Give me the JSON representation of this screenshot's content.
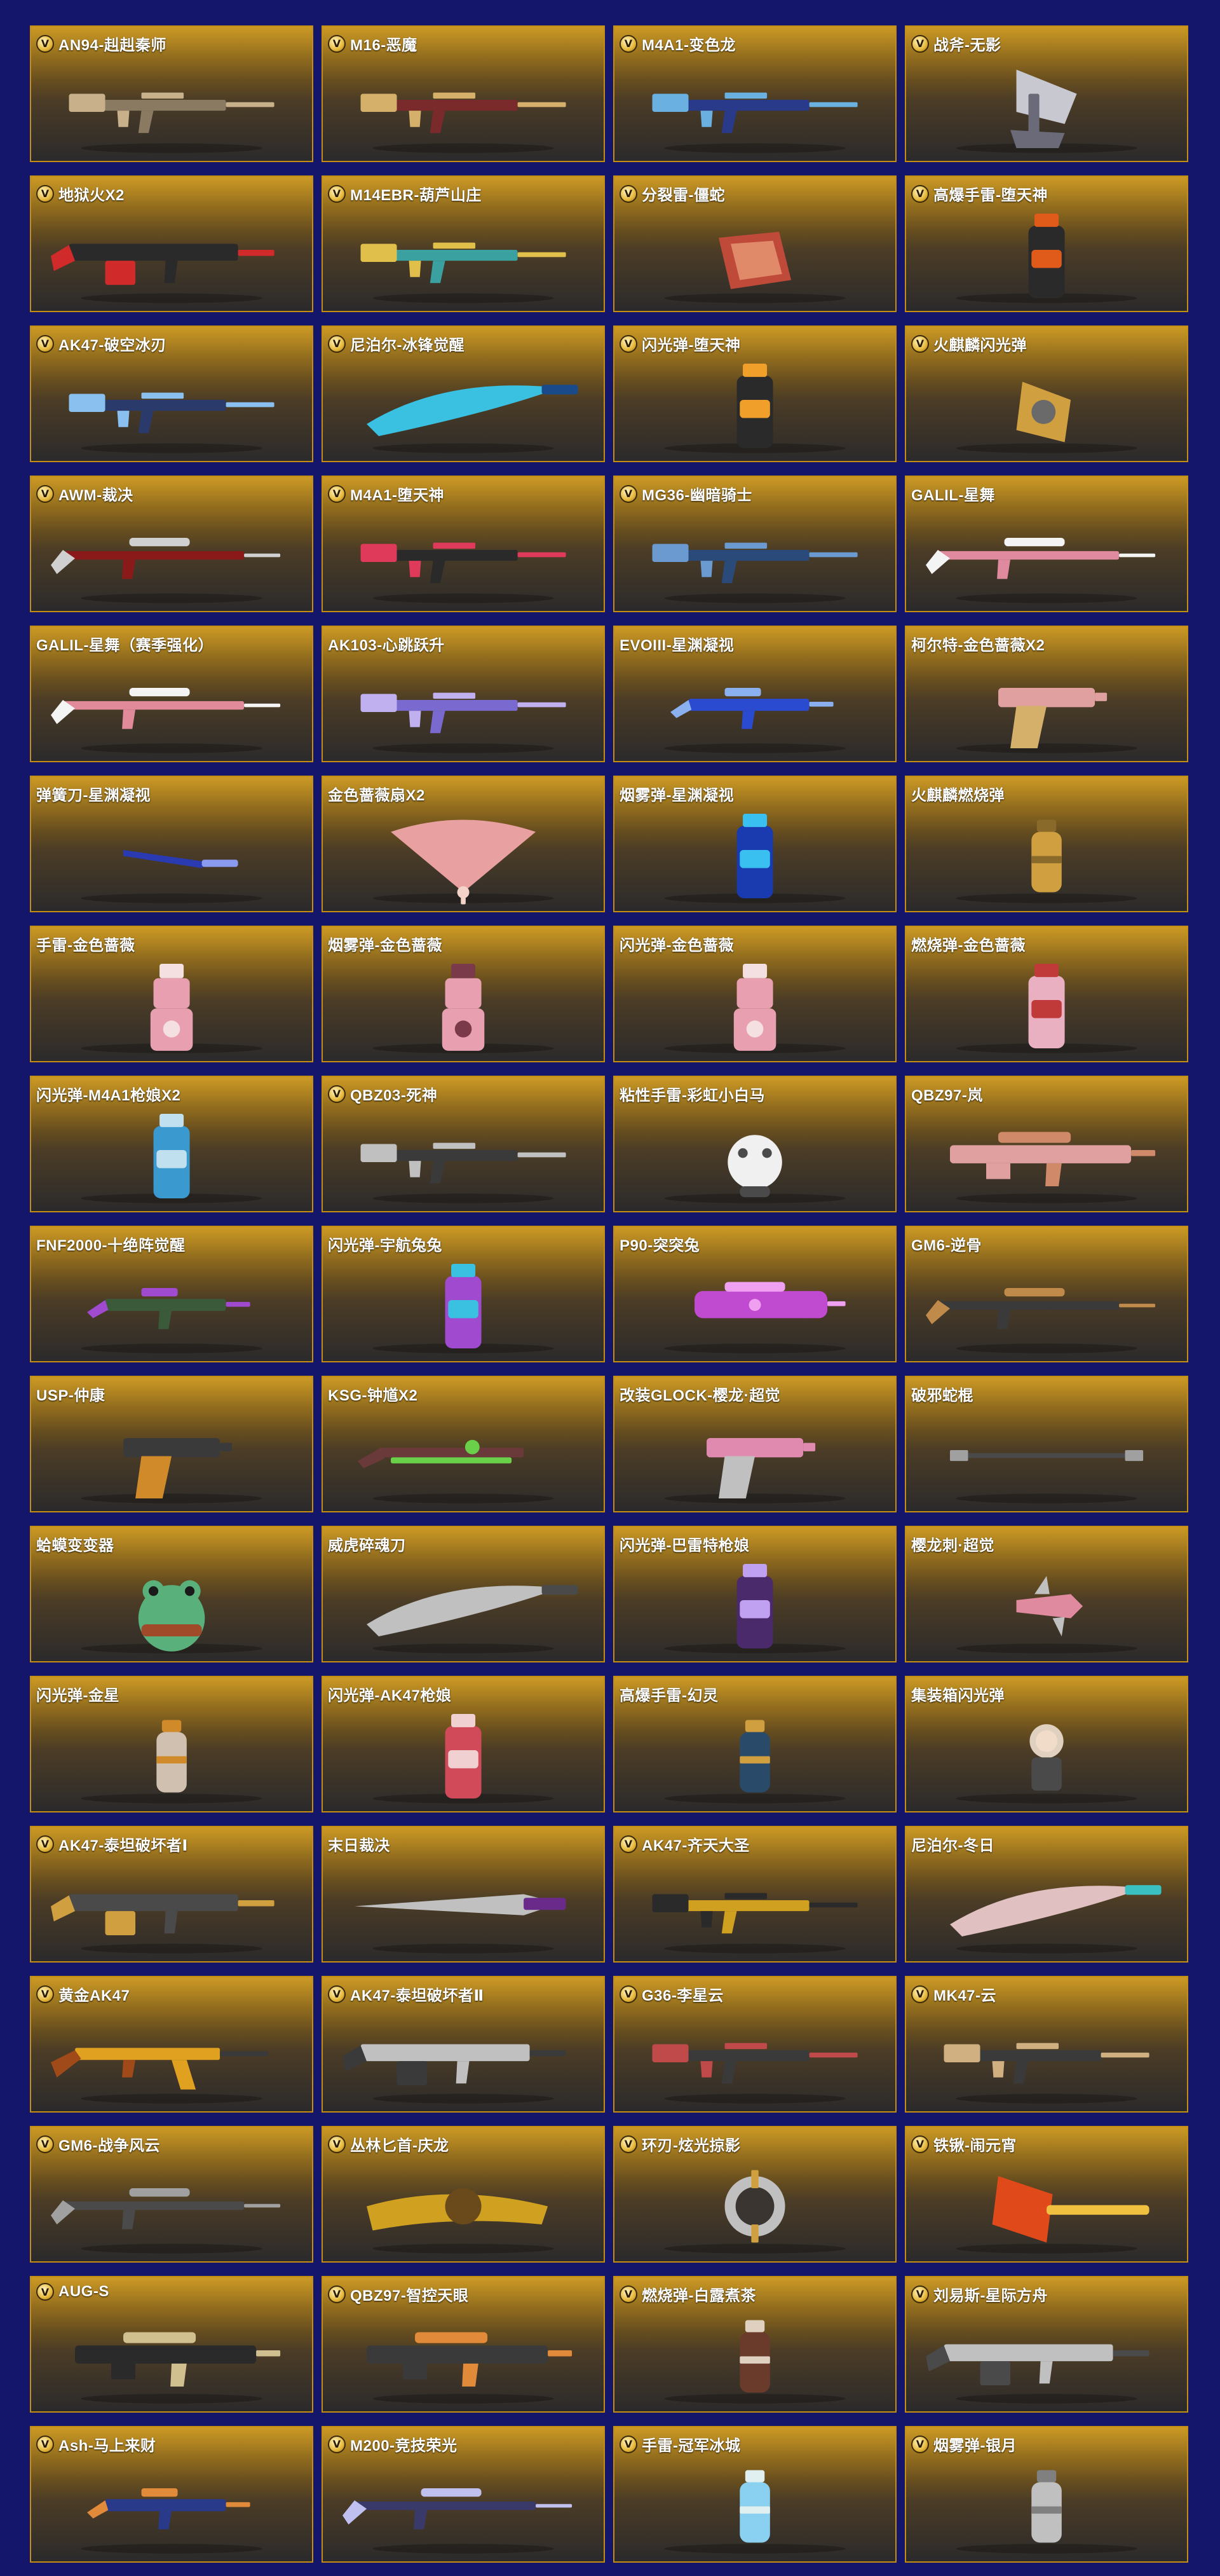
{
  "colors": {
    "background": "#13166a",
    "card_border": "#c48e12",
    "card_top": "#c08a12",
    "card_bottom": "#2b2a2b"
  },
  "badge_letter": "V",
  "items": [
    {
      "name": "AN94-赳赳秦师",
      "vip": true,
      "icon": "rifle-icon",
      "palette": [
        "#8a7a62",
        "#c8b08a"
      ]
    },
    {
      "name": "M16-恶魔",
      "vip": true,
      "icon": "rifle-icon",
      "palette": [
        "#7a2a2a",
        "#d4b06a"
      ]
    },
    {
      "name": "M4A1-变色龙",
      "vip": true,
      "icon": "rifle-icon",
      "palette": [
        "#2a3a8a",
        "#6ab0e0"
      ]
    },
    {
      "name": "战斧-无影",
      "vip": true,
      "icon": "axe-icon",
      "palette": [
        "#c8c8d0",
        "#6a6a78"
      ]
    },
    {
      "name": "地狱火X2",
      "vip": true,
      "icon": "machine-gun-icon",
      "palette": [
        "#2a2a2a",
        "#d02a2a"
      ]
    },
    {
      "name": "M14EBR-葫芦山庄",
      "vip": true,
      "icon": "rifle-icon",
      "palette": [
        "#3aa0a0",
        "#e0c04a"
      ]
    },
    {
      "name": "分裂雷-僵蛇",
      "vip": true,
      "icon": "box-grenade-icon",
      "palette": [
        "#c04a3a",
        "#e08a6a"
      ]
    },
    {
      "name": "高爆手雷-堕天神",
      "vip": true,
      "icon": "canister-icon",
      "palette": [
        "#2a2a2a",
        "#e05a1a"
      ]
    },
    {
      "name": "AK47-破空冰刃",
      "vip": true,
      "icon": "rifle-icon",
      "palette": [
        "#2a3a6a",
        "#8ac0f0"
      ]
    },
    {
      "name": "尼泊尔-冰锋觉醒",
      "vip": true,
      "icon": "blade-icon",
      "palette": [
        "#3ac0e0",
        "#1a4a8a"
      ]
    },
    {
      "name": "闪光弹-堕天神",
      "vip": true,
      "icon": "canister-icon",
      "palette": [
        "#2a2a2a",
        "#f0a02a"
      ]
    },
    {
      "name": "火麒麟闪光弹",
      "vip": true,
      "icon": "ornate-grenade-icon",
      "palette": [
        "#d0a040",
        "#6a6a6a"
      ]
    },
    {
      "name": "AWM-裁决",
      "vip": true,
      "icon": "sniper-icon",
      "palette": [
        "#8a1a1a",
        "#d0d0d0"
      ]
    },
    {
      "name": "M4A1-堕天神",
      "vip": true,
      "icon": "rifle-icon",
      "palette": [
        "#2a2a2a",
        "#e03a5a"
      ]
    },
    {
      "name": "MG36-幽暗骑士",
      "vip": true,
      "icon": "rifle-icon",
      "palette": [
        "#2a4a7a",
        "#6a9ad0"
      ]
    },
    {
      "name": "GALIL-星舞",
      "vip": false,
      "icon": "sniper-icon",
      "palette": [
        "#e08aa0",
        "#f4f4f4"
      ]
    },
    {
      "name": "GALIL-星舞（赛季强化）",
      "vip": false,
      "icon": "sniper-icon",
      "palette": [
        "#e08a9a",
        "#f4f4f4"
      ]
    },
    {
      "name": "AK103-心跳跃升",
      "vip": false,
      "icon": "rifle-icon",
      "palette": [
        "#7a6ad0",
        "#c0b0f0"
      ]
    },
    {
      "name": "EVOIII-星渊凝视",
      "vip": false,
      "icon": "smg-icon",
      "palette": [
        "#2a4ad0",
        "#8ab0f0"
      ]
    },
    {
      "name": "柯尔特-金色蔷薇X2",
      "vip": false,
      "icon": "pistol-icon",
      "palette": [
        "#e0a0a0",
        "#d4b06a"
      ]
    },
    {
      "name": "弹簧刀-星渊凝视",
      "vip": false,
      "icon": "knife-icon",
      "palette": [
        "#2a3ab0",
        "#8a9af0"
      ]
    },
    {
      "name": "金色蔷薇扇X2",
      "vip": false,
      "icon": "fan-icon",
      "palette": [
        "#e8a0a0",
        "#f4d4c8"
      ]
    },
    {
      "name": "烟雾弹-星渊凝视",
      "vip": false,
      "icon": "canister-icon",
      "palette": [
        "#1a3ab0",
        "#3ac0f0"
      ]
    },
    {
      "name": "火麒麟燃烧弹",
      "vip": false,
      "icon": "small-grenade-icon",
      "palette": [
        "#d0a040",
        "#8a6a2a"
      ]
    },
    {
      "name": "手雷-金色蔷薇",
      "vip": false,
      "icon": "tower-grenade-icon",
      "palette": [
        "#e8a0b0",
        "#f4e0e0"
      ]
    },
    {
      "name": "烟雾弹-金色蔷薇",
      "vip": false,
      "icon": "tower-grenade-icon",
      "palette": [
        "#e8a0b0",
        "#7a3a4a"
      ]
    },
    {
      "name": "闪光弹-金色蔷薇",
      "vip": false,
      "icon": "tower-grenade-icon",
      "palette": [
        "#e8a0b0",
        "#f4e0e0"
      ]
    },
    {
      "name": "燃烧弹-金色蔷薇",
      "vip": false,
      "icon": "canister-icon",
      "palette": [
        "#e8b0c0",
        "#c03a3a"
      ]
    },
    {
      "name": "闪光弹-M4A1枪娘X2",
      "vip": false,
      "icon": "canister-icon",
      "palette": [
        "#3a9ad0",
        "#c0e0f0"
      ]
    },
    {
      "name": "QBZ03-死神",
      "vip": true,
      "icon": "rifle-icon",
      "palette": [
        "#3a3a3a",
        "#c0c0c0"
      ]
    },
    {
      "name": "粘性手雷-彩虹小白马",
      "vip": false,
      "icon": "creature-icon",
      "palette": [
        "#f0f0f0",
        "#4a4a4a"
      ]
    },
    {
      "name": "QBZ97-岚",
      "vip": false,
      "icon": "bullpup-icon",
      "palette": [
        "#e0a0a0",
        "#d08a6a"
      ]
    },
    {
      "name": "FNF2000-十绝阵觉醒",
      "vip": false,
      "icon": "smg-icon",
      "palette": [
        "#3a5a3a",
        "#a04ad0"
      ]
    },
    {
      "name": "闪光弹-宇航兔兔",
      "vip": false,
      "icon": "canister-icon",
      "palette": [
        "#a04ad0",
        "#3ac0e0"
      ]
    },
    {
      "name": "P90-突突兔",
      "vip": false,
      "icon": "p90-icon",
      "palette": [
        "#c04ad0",
        "#f0a0f0"
      ]
    },
    {
      "name": "GM6-逆骨",
      "vip": false,
      "icon": "sniper-icon",
      "palette": [
        "#3a3a3a",
        "#c08a4a"
      ]
    },
    {
      "name": "USP-仲康",
      "vip": false,
      "icon": "pistol-icon",
      "palette": [
        "#3a3a3a",
        "#d08a2a"
      ]
    },
    {
      "name": "KSG-钟馗X2",
      "vip": false,
      "icon": "shotgun-icon",
      "palette": [
        "#6a3a3a",
        "#6ad04a"
      ]
    },
    {
      "name": "改装GLOCK-樱龙·超觉",
      "vip": false,
      "icon": "pistol-icon",
      "palette": [
        "#e08ab0",
        "#c0c0c0"
      ]
    },
    {
      "name": "破邪蛇棍",
      "vip": false,
      "icon": "staff-icon",
      "palette": [
        "#4a4a4a",
        "#a0a0a0"
      ]
    },
    {
      "name": "蛤蟆变变器",
      "vip": false,
      "icon": "frog-icon",
      "palette": [
        "#5ab07a",
        "#a04a2a"
      ]
    },
    {
      "name": "威虎碎魂刀",
      "vip": false,
      "icon": "blade-icon",
      "palette": [
        "#c0c0c0",
        "#4a4a4a"
      ]
    },
    {
      "name": "闪光弹-巴雷特枪娘",
      "vip": false,
      "icon": "canister-icon",
      "palette": [
        "#4a2a6a",
        "#c0a0f0"
      ]
    },
    {
      "name": "樱龙刺·超觉",
      "vip": false,
      "icon": "claw-icon",
      "palette": [
        "#e08aa0",
        "#c0c0c0"
      ]
    },
    {
      "name": "闪光弹-金星",
      "vip": false,
      "icon": "small-grenade-icon",
      "palette": [
        "#d0c0b0",
        "#d08a2a"
      ]
    },
    {
      "name": "闪光弹-AK47枪娘",
      "vip": false,
      "icon": "canister-icon",
      "palette": [
        "#d04a5a",
        "#f0d0d0"
      ]
    },
    {
      "name": "高爆手雷-幻灵",
      "vip": false,
      "icon": "small-grenade-icon",
      "palette": [
        "#2a4a6a",
        "#d0a040"
      ]
    },
    {
      "name": "集装箱闪光弹",
      "vip": false,
      "icon": "character-icon",
      "palette": [
        "#e0d0c0",
        "#4a4a4a"
      ]
    },
    {
      "name": "AK47-泰坦破坏者Ⅰ",
      "vip": true,
      "icon": "machine-gun-icon",
      "palette": [
        "#4a4a4a",
        "#d0a040"
      ]
    },
    {
      "name": "末日裁决",
      "vip": false,
      "icon": "long-blade-icon",
      "palette": [
        "#c0c0c0",
        "#6a2a8a"
      ]
    },
    {
      "name": "AK47-齐天大圣",
      "vip": true,
      "icon": "rifle-icon",
      "palette": [
        "#d0a020",
        "#2a2a2a"
      ]
    },
    {
      "name": "尼泊尔-冬日",
      "vip": false,
      "icon": "blade-icon",
      "palette": [
        "#e0c0c0",
        "#3ac0c0"
      ]
    },
    {
      "name": "黄金AK47",
      "vip": true,
      "icon": "ak-icon",
      "palette": [
        "#e0a020",
        "#a04a1a"
      ]
    },
    {
      "name": "AK47-泰坦破坏者Ⅱ",
      "vip": true,
      "icon": "machine-gun-icon",
      "palette": [
        "#c0c0c0",
        "#3a3a3a"
      ]
    },
    {
      "name": "G36-李星云",
      "vip": true,
      "icon": "rifle-icon",
      "palette": [
        "#3a3a3a",
        "#c04a4a"
      ]
    },
    {
      "name": "MK47-云",
      "vip": true,
      "icon": "rifle-icon",
      "palette": [
        "#3a3a3a",
        "#d0b080"
      ]
    },
    {
      "name": "GM6-战争风云",
      "vip": true,
      "icon": "sniper-icon",
      "palette": [
        "#4a4a4a",
        "#a0a0a0"
      ]
    },
    {
      "name": "丛林匕首-庆龙",
      "vip": true,
      "icon": "dragon-blade-icon",
      "palette": [
        "#d0a020",
        "#6a4a1a"
      ]
    },
    {
      "name": "环刃-炫光掠影",
      "vip": true,
      "icon": "ring-blade-icon",
      "palette": [
        "#c0c0c0",
        "#d0a040"
      ]
    },
    {
      "name": "铁锹-闹元宵",
      "vip": true,
      "icon": "shovel-icon",
      "palette": [
        "#e04a1a",
        "#f0c040"
      ]
    },
    {
      "name": "AUG-S",
      "vip": true,
      "icon": "bullpup-icon",
      "palette": [
        "#2a2a2a",
        "#d0c090"
      ]
    },
    {
      "name": "QBZ97-智控天眼",
      "vip": true,
      "icon": "bullpup-icon",
      "palette": [
        "#3a3a3a",
        "#e08a3a"
      ]
    },
    {
      "name": "燃烧弹-白露煮茶",
      "vip": true,
      "icon": "small-grenade-icon",
      "palette": [
        "#6a3a2a",
        "#e0d0c0"
      ]
    },
    {
      "name": "刘易斯-星际方舟",
      "vip": true,
      "icon": "machine-gun-icon",
      "palette": [
        "#c0c0c0",
        "#4a4a4a"
      ]
    },
    {
      "name": "Ash-马上来财",
      "vip": true,
      "icon": "smg-icon",
      "palette": [
        "#2a3a8a",
        "#e08a3a"
      ]
    },
    {
      "name": "M200-竞技荣光",
      "vip": true,
      "icon": "sniper-icon",
      "palette": [
        "#3a3a6a",
        "#c0c0f0"
      ]
    },
    {
      "name": "手雷-冠军冰城",
      "vip": true,
      "icon": "small-grenade-icon",
      "palette": [
        "#8ad0f0",
        "#e0f0f0"
      ]
    },
    {
      "name": "烟雾弹-银月",
      "vip": true,
      "icon": "small-grenade-icon",
      "palette": [
        "#c0c0c0",
        "#808080"
      ]
    }
  ]
}
